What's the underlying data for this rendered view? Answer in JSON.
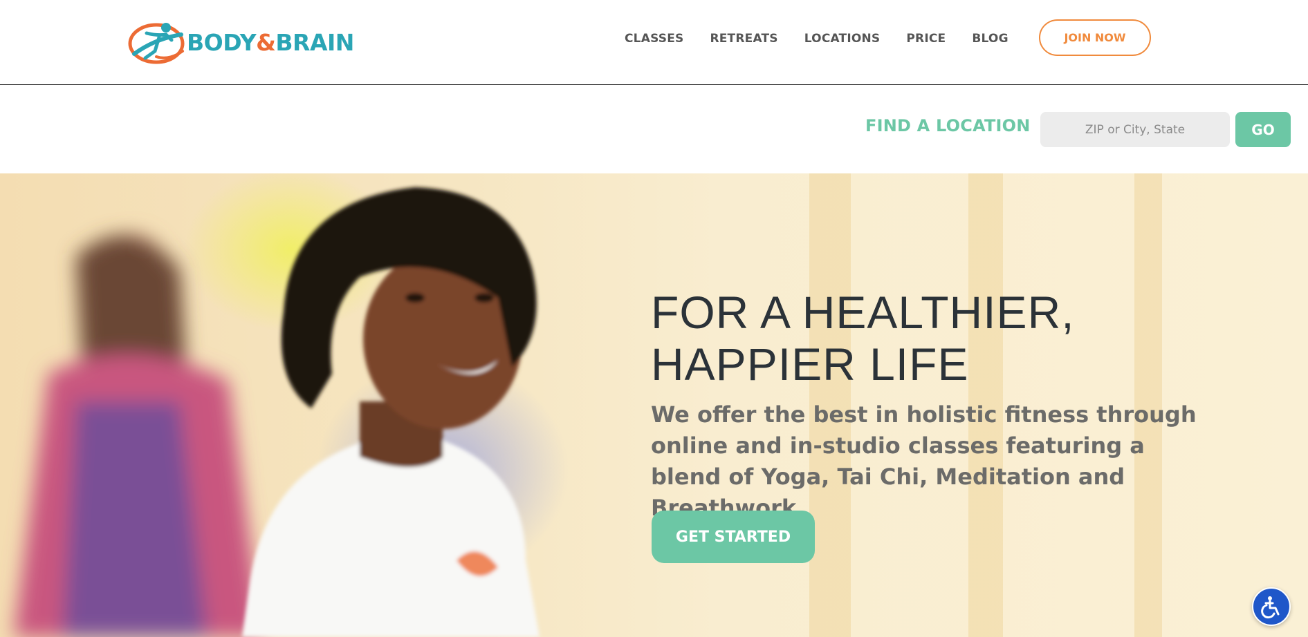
{
  "header": {
    "logo": {
      "text_main": "BODY",
      "text_amp": "&",
      "text_end": "BRAIN"
    },
    "nav": [
      "CLASSES",
      "RETREATS",
      "LOCATIONS",
      "PRICE",
      "BLOG"
    ],
    "join_label": "JOIN NOW"
  },
  "location": {
    "label": "FIND A LOCATION",
    "placeholder": "ZIP or City, State",
    "go_label": "GO"
  },
  "hero": {
    "heading_line1": "FOR A HEALTHIER,",
    "heading_line2": "HAPPIER LIFE",
    "subtext": "We offer the best in holistic fitness through online and in-studio classes featuring a blend of Yoga, Tai Chi, Meditation and Breathwork.",
    "cta_label": "GET STARTED"
  },
  "icons": {
    "accessibility": "accessibility-icon",
    "logo": "body-brain-logo-icon"
  },
  "colors": {
    "brand_teal": "#2aa5b5",
    "brand_orange": "#ec6b34",
    "accent_green": "#6cc7a5",
    "join_orange": "#f08a3c",
    "a11y_blue": "#1f57c9"
  }
}
